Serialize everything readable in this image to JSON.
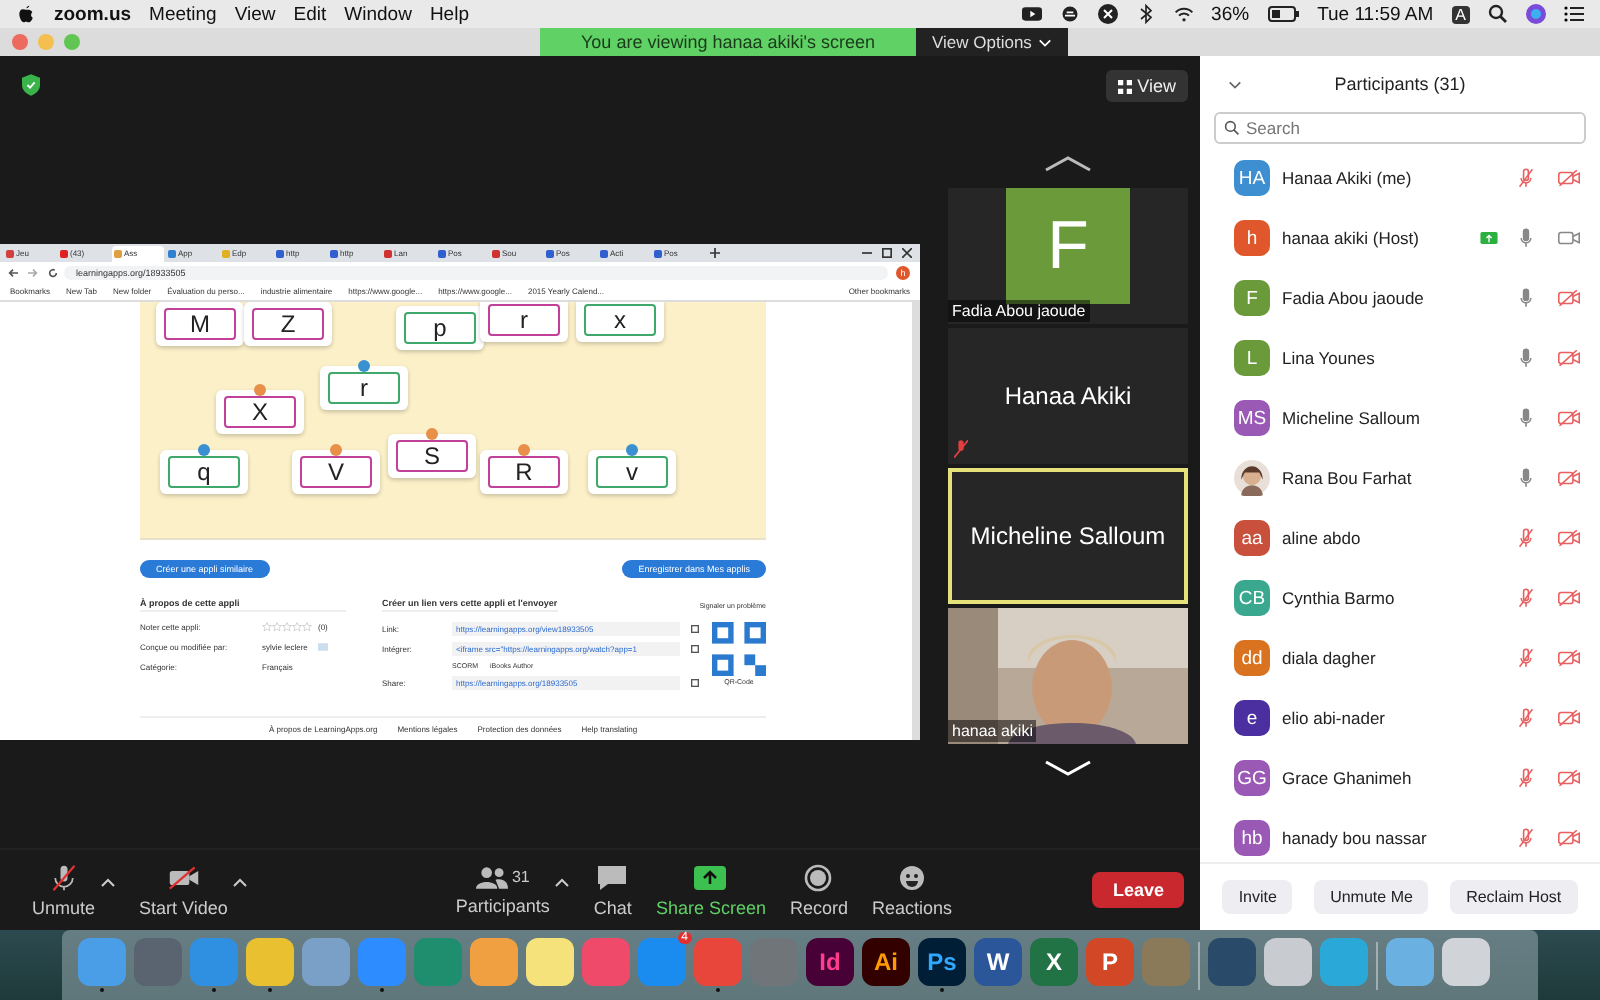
{
  "menu_bar": {
    "app": "zoom.us",
    "items": [
      "Meeting",
      "View",
      "Edit",
      "Window",
      "Help"
    ],
    "battery": "36%",
    "clock": "Tue 11:59 AM",
    "input_source": "A"
  },
  "banner": {
    "text": "You are viewing hanaa akiki's screen",
    "options": "View Options"
  },
  "view_button": "View",
  "shared_screen": {
    "tabs": [
      {
        "label": "Jeu",
        "selected": false,
        "color": "#d04040"
      },
      {
        "label": "(43)",
        "selected": false,
        "color": "#e02020"
      },
      {
        "label": "Ass",
        "selected": true,
        "color": "#e0a040"
      },
      {
        "label": "App",
        "selected": false,
        "color": "#3080d0"
      },
      {
        "label": "Edp",
        "selected": false,
        "color": "#e0b020"
      },
      {
        "label": "http",
        "selected": false,
        "color": "#3060d0"
      },
      {
        "label": "http",
        "selected": false,
        "color": "#3060d0"
      },
      {
        "label": "Lan",
        "selected": false,
        "color": "#d03030"
      },
      {
        "label": "Pos",
        "selected": false,
        "color": "#3060d0"
      },
      {
        "label": "Sou",
        "selected": false,
        "color": "#d03030"
      },
      {
        "label": "Pos",
        "selected": false,
        "color": "#3060d0"
      },
      {
        "label": "Acti",
        "selected": false,
        "color": "#3060d0"
      },
      {
        "label": "Pos",
        "selected": false,
        "color": "#3060d0"
      }
    ],
    "profile": "h",
    "address": "learningapps.org/18933505",
    "bookmarks": [
      "Bookmarks",
      "New Tab",
      "New folder",
      "Évaluation du perso...",
      "industrie alimentaire",
      "https://www.google...",
      "https://www.google...",
      "2015 Yearly Calend..."
    ],
    "other_bookmarks": "Other bookmarks",
    "cards": [
      {
        "letter": "M",
        "color": "#c0409a"
      },
      {
        "letter": "Z",
        "color": "#c0409a"
      },
      {
        "letter": "p",
        "color": "#40a86a"
      },
      {
        "letter": "r",
        "color": "#c0409a"
      },
      {
        "letter": "x",
        "color": "#40a86a"
      },
      {
        "letter": "r",
        "color": "#40a86a",
        "pin": {
          "color": "#3a90d0"
        }
      },
      {
        "letter": "X",
        "color": "#c0409a",
        "pin": {
          "color": "#e8904a"
        }
      },
      {
        "letter": "q",
        "color": "#40a86a",
        "pin": {
          "color": "#3a90d0"
        }
      },
      {
        "letter": "V",
        "color": "#c0409a",
        "pin": {
          "color": "#e8904a"
        }
      },
      {
        "letter": "S",
        "color": "#c0409a",
        "pin": {
          "color": "#e8904a"
        }
      },
      {
        "letter": "R",
        "color": "#c0409a",
        "pin": {
          "color": "#e8904a"
        }
      },
      {
        "letter": "v",
        "color": "#40a86a",
        "pin": {
          "color": "#3a90d0"
        }
      }
    ],
    "create_similar": "Créer une appli similaire",
    "save_button": "Enregistrer dans Mes applis",
    "about": {
      "title": "À propos de cette appli",
      "rows": [
        {
          "label": "Noter cette appli:",
          "kind": "rating",
          "stars": 0,
          "count": "(0)"
        },
        {
          "label": "Conçue ou modifiée par:",
          "kind": "author",
          "value": "sylvie leclere"
        },
        {
          "label": "Catégorie:",
          "kind": "text",
          "value": "Français"
        }
      ]
    },
    "share": {
      "title": "Créer un lien vers cette appli et l'envoyer",
      "report": "Signaler un problème",
      "rows": [
        {
          "label": "Link:",
          "value": "https://learningapps.org/view18933505"
        },
        {
          "label": "Intégrer:",
          "value": "<iframe src=\"https://learningapps.org/watch?app=1"
        },
        {
          "label": "Share:",
          "value": "https://learningapps.org/18933505"
        }
      ],
      "exports": [
        "SCORM",
        "iBooks Author"
      ],
      "qr_label": "QR-Code"
    },
    "footer": [
      "À propos de LearningApps.org",
      "Mentions légales",
      "Protection des données",
      "Help translating"
    ]
  },
  "thumbnails": [
    {
      "kind": "initial",
      "initial": "F",
      "name": "Fadia Abou jaoude",
      "speaking": false,
      "muted": false
    },
    {
      "kind": "name",
      "name": "Hanaa Akiki",
      "speaking": false,
      "muted": true
    },
    {
      "kind": "name",
      "name": "Micheline Salloum",
      "speaking": true,
      "muted": false
    },
    {
      "kind": "video",
      "name": "hanaa akiki",
      "speaking": false,
      "muted": false
    }
  ],
  "participants": {
    "title": "Participants (31)",
    "search": {
      "placeholder": "Search"
    },
    "items": [
      {
        "initials": "HA",
        "color": "#3d8fd1",
        "name": "Hanaa Akiki (me)",
        "muted": true,
        "video": false,
        "sharing": false
      },
      {
        "initials": "h",
        "color": "#e0572b",
        "name": "hanaa akiki (Host)",
        "muted": false,
        "video": true,
        "sharing": true
      },
      {
        "initials": "F",
        "color": "#6a9a3a",
        "name": "Fadia Abou jaoude",
        "muted": false,
        "video": false,
        "sharing": false
      },
      {
        "initials": "L",
        "color": "#6a9a3a",
        "name": "Lina Younes",
        "muted": false,
        "video": false,
        "sharing": false
      },
      {
        "initials": "MS",
        "color": "#9b59b6",
        "name": "Micheline Salloum",
        "muted": false,
        "video": false,
        "sharing": false
      },
      {
        "kind": "picture",
        "name": "Rana Bou Farhat",
        "muted": false,
        "video": false,
        "sharing": false
      },
      {
        "initials": "aa",
        "color": "#c9503c",
        "name": "aline abdo",
        "muted": true,
        "video": false,
        "sharing": false
      },
      {
        "initials": "CB",
        "color": "#3aa88f",
        "name": "Cynthia Barmo",
        "muted": true,
        "video": false,
        "sharing": false
      },
      {
        "initials": "dd",
        "color": "#d9731f",
        "name": "diala dagher",
        "muted": true,
        "video": false,
        "sharing": false
      },
      {
        "initials": "e",
        "color": "#4b2ea0",
        "name": "elio abi-nader",
        "muted": true,
        "video": false,
        "sharing": false
      },
      {
        "initials": "GG",
        "color": "#9b59b6",
        "name": "Grace Ghanimeh",
        "muted": true,
        "video": false,
        "sharing": false
      },
      {
        "initials": "hb",
        "color": "#9b59b6",
        "name": "hanady bou nassar",
        "muted": true,
        "video": false,
        "sharing": false
      }
    ],
    "buttons": [
      "Invite",
      "Unmute Me",
      "Reclaim Host"
    ]
  },
  "toolbar": {
    "unmute": "Unmute",
    "muted": true,
    "video": "Start Video",
    "video_off": true,
    "participants": "Participants",
    "participant_count": "31",
    "chat": "Chat",
    "share": "Share Screen",
    "record": "Record",
    "reactions": "Reactions",
    "leave": "Leave"
  },
  "dock": [
    {
      "kind": "app",
      "color": "#4a9ee8",
      "running": true
    },
    {
      "kind": "app",
      "color": "#5a6470",
      "running": false
    },
    {
      "kind": "app",
      "color": "#2f8fe0",
      "running": true
    },
    {
      "kind": "app",
      "color": "#e8c030",
      "running": true
    },
    {
      "kind": "app",
      "color": "#7aa0c8",
      "running": false
    },
    {
      "kind": "app",
      "color": "#2d8cff",
      "running": true
    },
    {
      "kind": "app",
      "color": "#1e8e6e",
      "running": false
    },
    {
      "kind": "app",
      "color": "#f0a040",
      "running": false
    },
    {
      "kind": "app",
      "color": "#f5e27a",
      "running": false
    },
    {
      "kind": "app",
      "color": "#f04a6a",
      "running": false
    },
    {
      "kind": "app",
      "color": "#1a8cf0",
      "running": false,
      "badge": "4"
    },
    {
      "kind": "app",
      "color": "#e8463a",
      "running": true
    },
    {
      "kind": "app",
      "color": "#70757a",
      "running": false
    },
    {
      "kind": "app",
      "color": "#470137",
      "running": false,
      "label": {
        "text": "Id",
        "color": "#ff3d8f"
      }
    },
    {
      "kind": "app",
      "color": "#330000",
      "running": false,
      "label": {
        "text": "Ai",
        "color": "#ff9a00"
      }
    },
    {
      "kind": "app",
      "color": "#001e36",
      "running": true,
      "label": {
        "text": "Ps",
        "color": "#31a8ff"
      }
    },
    {
      "kind": "app",
      "color": "#2b579a",
      "running": false,
      "label": {
        "text": "W",
        "color": "#ffffff"
      }
    },
    {
      "kind": "app",
      "color": "#217346",
      "running": false,
      "label": {
        "text": "X",
        "color": "#ffffff"
      }
    },
    {
      "kind": "app",
      "color": "#d24726",
      "running": false,
      "label": {
        "text": "P",
        "color": "#ffffff"
      }
    },
    {
      "kind": "app",
      "color": "#8a7a5a",
      "running": false
    },
    {
      "kind": "separator"
    },
    {
      "kind": "app",
      "color": "#2a4a6a",
      "running": false
    },
    {
      "kind": "app",
      "color": "#c8ccd0",
      "running": false
    },
    {
      "kind": "app",
      "color": "#2aa8d8",
      "running": false
    },
    {
      "kind": "separator"
    },
    {
      "kind": "app",
      "color": "#6ab0e0",
      "running": false
    },
    {
      "kind": "app",
      "color": "#d0d4d8",
      "running": false
    }
  ]
}
